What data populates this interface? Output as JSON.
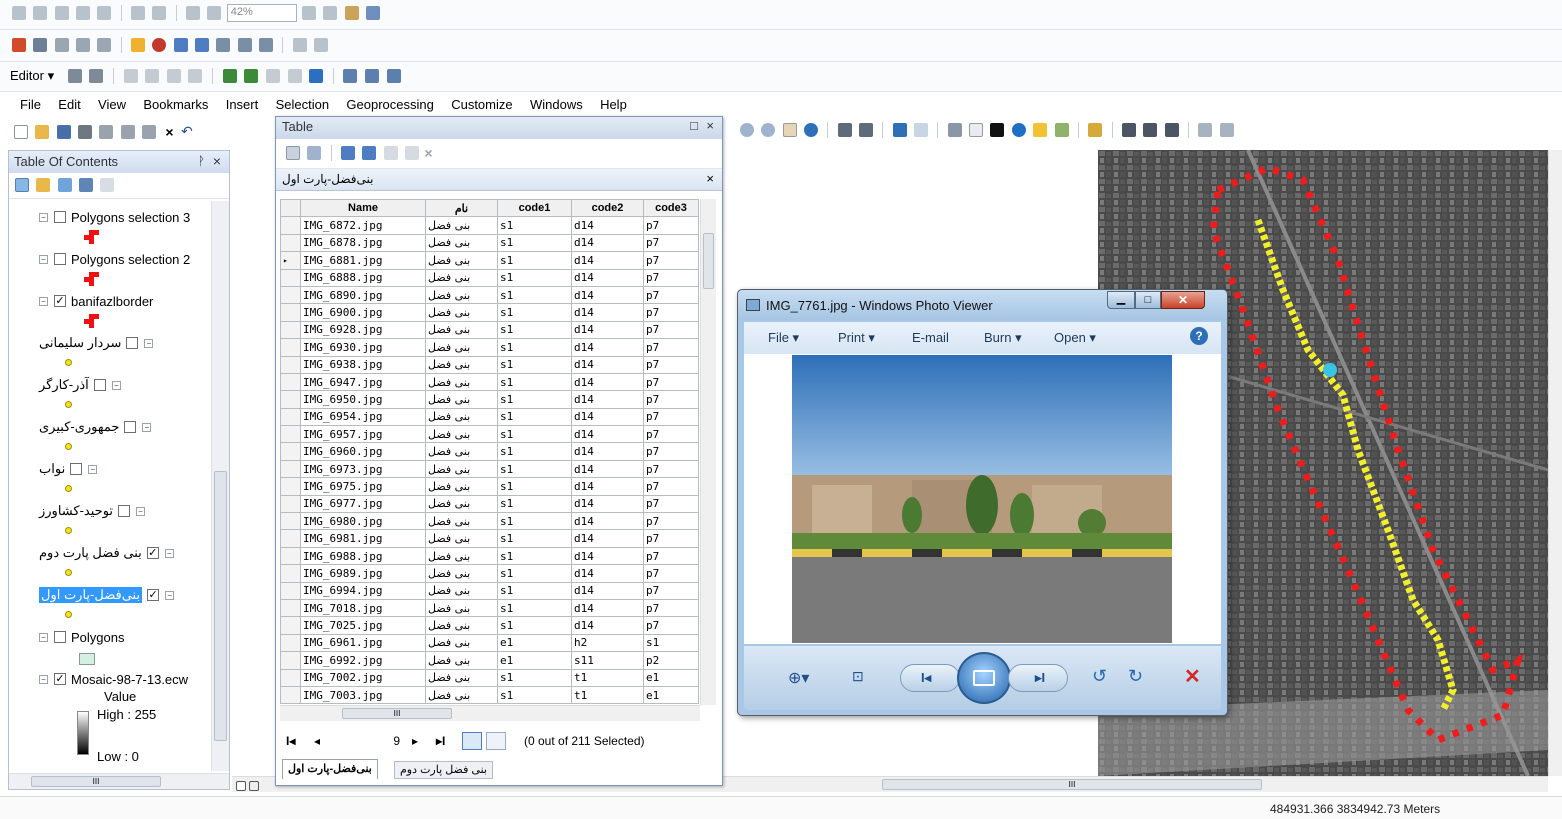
{
  "toolbars": {
    "zoom_value": "42%",
    "editor_label": "Editor ▾"
  },
  "menu": [
    "File",
    "Edit",
    "View",
    "Bookmarks",
    "Insert",
    "Selection",
    "Geoprocessing",
    "Customize",
    "Windows",
    "Help"
  ],
  "toc": {
    "title": "Table Of Contents",
    "pin": "ᚹ",
    "close": "×",
    "layers": [
      {
        "label": "Polygons selection 3",
        "checked": false
      },
      {
        "label": "Polygons selection 2",
        "checked": false
      },
      {
        "label": "banifazlborder",
        "checked": true
      },
      {
        "label": "سردار سلیمانی",
        "checked": false
      },
      {
        "label": "آذر-کارگر",
        "checked": false
      },
      {
        "label": "جمهوری-کبیری",
        "checked": false
      },
      {
        "label": "نواب",
        "checked": false
      },
      {
        "label": "توحید-کشاورز",
        "checked": false
      },
      {
        "label": "بنی فضل پارت دوم",
        "checked": true
      },
      {
        "label": "بنی‌فضل-پارت اول",
        "checked": true
      },
      {
        "label": "Polygons",
        "checked": false
      },
      {
        "label": "Mosaic-98-7-13.ecw",
        "checked": true
      }
    ],
    "raster_value": "Value",
    "raster_high": "High : 255",
    "raster_low": "Low : 0",
    "scroll_marker": "III"
  },
  "table": {
    "window_title": "Table",
    "layer_title": "بنی‌فضل-پارت اول",
    "columns": [
      "Name",
      "نام",
      "code1",
      "code2",
      "code3"
    ],
    "rows": [
      [
        "IMG_6872.jpg",
        "بنی فضل",
        "s1",
        "d14",
        "p7"
      ],
      [
        "IMG_6878.jpg",
        "بنی فضل",
        "s1",
        "d14",
        "p7"
      ],
      [
        "IMG_6881.jpg",
        "بنی فضل",
        "s1",
        "d14",
        "p7"
      ],
      [
        "IMG_6888.jpg",
        "بنی فضل",
        "s1",
        "d14",
        "p7"
      ],
      [
        "IMG_6890.jpg",
        "بنی فضل",
        "s1",
        "d14",
        "p7"
      ],
      [
        "IMG_6900.jpg",
        "بنی فضل",
        "s1",
        "d14",
        "p7"
      ],
      [
        "IMG_6928.jpg",
        "بنی فضل",
        "s1",
        "d14",
        "p7"
      ],
      [
        "IMG_6930.jpg",
        "بنی فضل",
        "s1",
        "d14",
        "p7"
      ],
      [
        "IMG_6938.jpg",
        "بنی فضل",
        "s1",
        "d14",
        "p7"
      ],
      [
        "IMG_6947.jpg",
        "بنی فضل",
        "s1",
        "d14",
        "p7"
      ],
      [
        "IMG_6950.jpg",
        "بنی فضل",
        "s1",
        "d14",
        "p7"
      ],
      [
        "IMG_6954.jpg",
        "بنی فضل",
        "s1",
        "d14",
        "p7"
      ],
      [
        "IMG_6957.jpg",
        "بنی فضل",
        "s1",
        "d14",
        "p7"
      ],
      [
        "IMG_6960.jpg",
        "بنی فضل",
        "s1",
        "d14",
        "p7"
      ],
      [
        "IMG_6973.jpg",
        "بنی فضل",
        "s1",
        "d14",
        "p7"
      ],
      [
        "IMG_6975.jpg",
        "بنی فضل",
        "s1",
        "d14",
        "p7"
      ],
      [
        "IMG_6977.jpg",
        "بنی فضل",
        "s1",
        "d14",
        "p7"
      ],
      [
        "IMG_6980.jpg",
        "بنی فضل",
        "s1",
        "d14",
        "p7"
      ],
      [
        "IMG_6981.jpg",
        "بنی فضل",
        "s1",
        "d14",
        "p7"
      ],
      [
        "IMG_6988.jpg",
        "بنی فضل",
        "s1",
        "d14",
        "p7"
      ],
      [
        "IMG_6989.jpg",
        "بنی فضل",
        "s1",
        "d14",
        "p7"
      ],
      [
        "IMG_6994.jpg",
        "بنی فضل",
        "s1",
        "d14",
        "p7"
      ],
      [
        "IMG_7018.jpg",
        "بنی فضل",
        "s1",
        "d14",
        "p7"
      ],
      [
        "IMG_7025.jpg",
        "بنی فضل",
        "s1",
        "d14",
        "p7"
      ],
      [
        "IMG_6961.jpg",
        "بنی فضل",
        "e1",
        "h2",
        "s1"
      ],
      [
        "IMG_6992.jpg",
        "بنی فضل",
        "e1",
        "s11",
        "p2"
      ],
      [
        "IMG_7002.jpg",
        "بنی فضل",
        "s1",
        "t1",
        "e1"
      ],
      [
        "IMG_7003.jpg",
        "بنی فضل",
        "s1",
        "t1",
        "e1"
      ]
    ],
    "current_record": "9",
    "selection_status": "(0 out of 211 Selected)",
    "tabs": [
      "بنی‌فضل-پارت اول",
      "بنی فضل پارت دوم"
    ],
    "nav_first": "I◂",
    "nav_prev": "◂",
    "nav_next": "▸",
    "nav_last": "▸I",
    "hscroll_marker": "III"
  },
  "photo_viewer": {
    "title": "IMG_7761.jpg - Windows Photo Viewer",
    "menu": [
      "File ▾",
      "Print ▾",
      "E-mail",
      "Burn ▾",
      "Open ▾"
    ],
    "help": "?"
  },
  "map": {
    "hscroll_marker": "III"
  },
  "status_bar": {
    "coordinates": "484931.366  3834942.73 Meters"
  }
}
